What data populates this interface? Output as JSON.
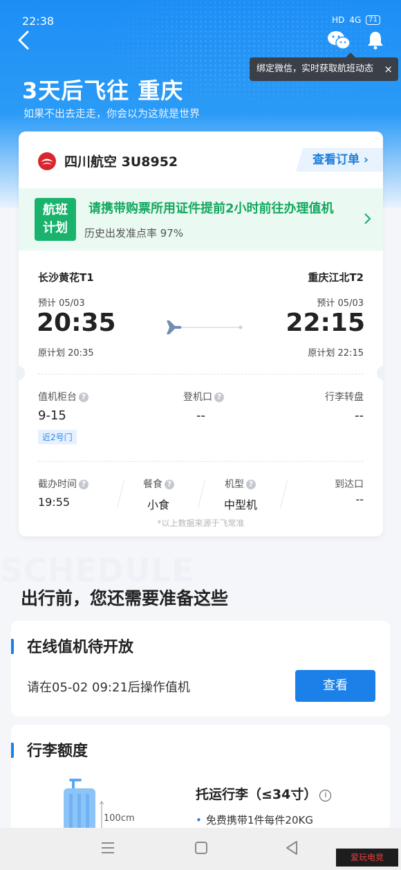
{
  "status_bar": {
    "time": "22:38",
    "signal": "HD",
    "network": "4G",
    "battery": "71"
  },
  "header": {
    "title": "3天后飞往 重庆",
    "subtitle": "如果不出去走走，你会以为这就是世界",
    "tooltip": "绑定微信，实时获取航班动态",
    "tooltip_close": "×"
  },
  "flight": {
    "airline": "四川航空 3U8952",
    "order_button": "查看订单 ›",
    "notice_badge_line1": "航班",
    "notice_badge_line2": "计划",
    "notice_main": "请携带购票所用证件提前2小时前往办理值机",
    "notice_sub": "历史出发准点率 97%",
    "departure": {
      "airport": "长沙黄花T1",
      "estimated": "预计 05/03",
      "time": "20:35",
      "original": "原计划 20:35"
    },
    "arrival": {
      "airport": "重庆江北T2",
      "estimated": "预计 05/03",
      "time": "22:15",
      "original": "原计划 22:15"
    },
    "checkin_counter_label": "值机柜台",
    "checkin_counter_value": "9-15",
    "gate_hint": "近2号门",
    "boarding_gate_label": "登机口",
    "boarding_gate_value": "--",
    "baggage_carousel_label": "行李转盘",
    "baggage_carousel_value": "--",
    "cutoff_label": "截办时间",
    "cutoff_value": "19:55",
    "meal_label": "餐食",
    "meal_value": "小食",
    "aircraft_label": "机型",
    "aircraft_value": "中型机",
    "arrival_gate_label": "到达口",
    "arrival_gate_value": "--",
    "source": "*以上数据来源于飞常准",
    "help_glyph": "?"
  },
  "schedule_watermark": "SCHEDULE",
  "prep_title": "出行前，您还需要准备这些",
  "checkin": {
    "title": "在线值机待开放",
    "desc": "请在05-02 09:21后操作值机",
    "button": "查看"
  },
  "luggage": {
    "title": "行李额度",
    "checked_title": "托运行李（≤34寸）",
    "info_glyph": "i",
    "dimension": "100cm",
    "item": "免费携带1件每件20KG"
  },
  "colors": {
    "brand_blue": "#1b80e8",
    "green": "#19b36e"
  },
  "watermark": "爱玩电竞"
}
